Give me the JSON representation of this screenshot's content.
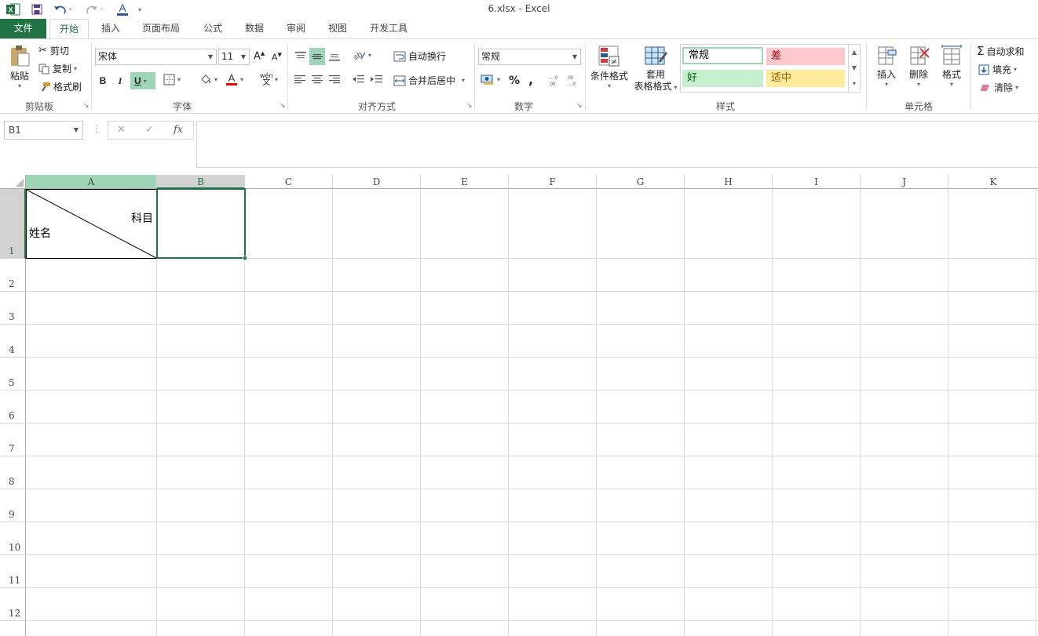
{
  "window": {
    "title": "6.xlsx - Excel"
  },
  "tabs": [
    {
      "label": "文件",
      "id": "file"
    },
    {
      "label": "开始",
      "id": "home"
    },
    {
      "label": "插入",
      "id": "insert"
    },
    {
      "label": "页面布局",
      "id": "page-layout"
    },
    {
      "label": "公式",
      "id": "formulas"
    },
    {
      "label": "数据",
      "id": "data"
    },
    {
      "label": "审阅",
      "id": "review"
    },
    {
      "label": "视图",
      "id": "view"
    },
    {
      "label": "开发工具",
      "id": "developer"
    }
  ],
  "ribbon": {
    "clipboard": {
      "label": "剪贴板",
      "paste": "粘贴",
      "cut": "剪切",
      "copy": "复制",
      "format_painter": "格式刷"
    },
    "font": {
      "label": "字体",
      "font_name": "宋体",
      "font_size": "11",
      "bold": "B",
      "italic": "I",
      "underline": "U",
      "phonetic": "wén"
    },
    "alignment": {
      "label": "对齐方式",
      "wrap_text": "自动换行",
      "merge_center": "合并后居中"
    },
    "number": {
      "label": "数字",
      "format": "常规",
      "percent": "%",
      "comma": ","
    },
    "cond_format": {
      "label": "条件格式"
    },
    "table_format": {
      "label_line1": "套用",
      "label_line2": "表格格式"
    },
    "styles": {
      "label": "样式",
      "normal": "常规",
      "bad": "差",
      "good": "好",
      "neutral": "适中"
    },
    "cells": {
      "label": "单元格",
      "insert": "插入",
      "delete": "删除",
      "format": "格式"
    },
    "editing": {
      "autosum": "自动求和",
      "fill": "填充",
      "clear": "清除"
    }
  },
  "formula_bar": {
    "name_box": "B1",
    "fx": "fx",
    "formula": ""
  },
  "columns": [
    "A",
    "B",
    "C",
    "D",
    "E",
    "F",
    "G",
    "H",
    "I",
    "J",
    "K"
  ],
  "rows": [
    "1",
    "2",
    "3",
    "4",
    "5",
    "6",
    "7",
    "8",
    "9",
    "10",
    "11",
    "12"
  ],
  "cells": {
    "A1_top_right": "科目",
    "A1_bottom_left": "姓名"
  },
  "selection": {
    "active_cell": "B1"
  },
  "colors": {
    "excel_green": "#217346",
    "style_bad_bg": "#ffc7ce",
    "style_bad_fg": "#9c0006",
    "style_good_bg": "#c6efce",
    "style_good_fg": "#006100",
    "style_neutral_bg": "#ffeb9c",
    "style_neutral_fg": "#9c5700"
  }
}
